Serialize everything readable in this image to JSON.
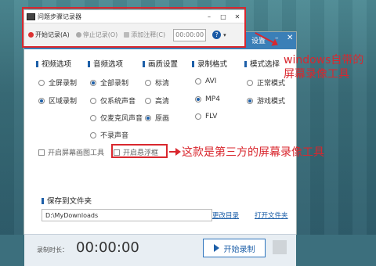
{
  "recorder": {
    "title": "问题步骤记录器",
    "controls": [
      "–",
      "□",
      "✕"
    ],
    "buttons": {
      "start": "开始记录(A)",
      "stop": "停止记录(O)",
      "comment": "添加注释(C)"
    },
    "time": "00:00:00"
  },
  "main": {
    "settings_label": "设置",
    "columns": [
      {
        "header": "视频选项",
        "options": [
          {
            "label": "全屏录制",
            "selected": false
          },
          {
            "label": "区域录制",
            "selected": true
          }
        ]
      },
      {
        "header": "音频选项",
        "options": [
          {
            "label": "全部录制",
            "selected": true
          },
          {
            "label": "仅系统声音",
            "selected": false
          },
          {
            "label": "仅麦克风声音",
            "selected": false
          },
          {
            "label": "不录声音",
            "selected": false
          }
        ]
      },
      {
        "header": "画质设置",
        "options": [
          {
            "label": "标清",
            "selected": false
          },
          {
            "label": "高清",
            "selected": false
          },
          {
            "label": "原画",
            "selected": true
          }
        ]
      },
      {
        "header": "录制格式",
        "options": [
          {
            "label": "AVI",
            "selected": false
          },
          {
            "label": "MP4",
            "selected": true
          },
          {
            "label": "FLV",
            "selected": false
          }
        ]
      },
      {
        "header": "模式选择",
        "options": [
          {
            "label": "正常模式",
            "selected": false
          },
          {
            "label": "游戏模式",
            "selected": true
          }
        ]
      }
    ],
    "checkboxes": {
      "brush": "开启屏幕画图工具",
      "float": "开启悬浮框"
    },
    "save_label": "保存到文件夹",
    "path": "D:\\MyDownloads",
    "change_dir": "更改目录",
    "open_folder": "打开文件夹",
    "duration_label": "录制时长：",
    "duration": "00:00:00",
    "start_button": "开始录制"
  },
  "annotations": {
    "note1": "windows自带的屏幕录像工具",
    "note2": "这款是第三方的屏幕录像工具"
  },
  "colors": {
    "accent": "#1d5fa8",
    "annotation": "#d9272e"
  }
}
